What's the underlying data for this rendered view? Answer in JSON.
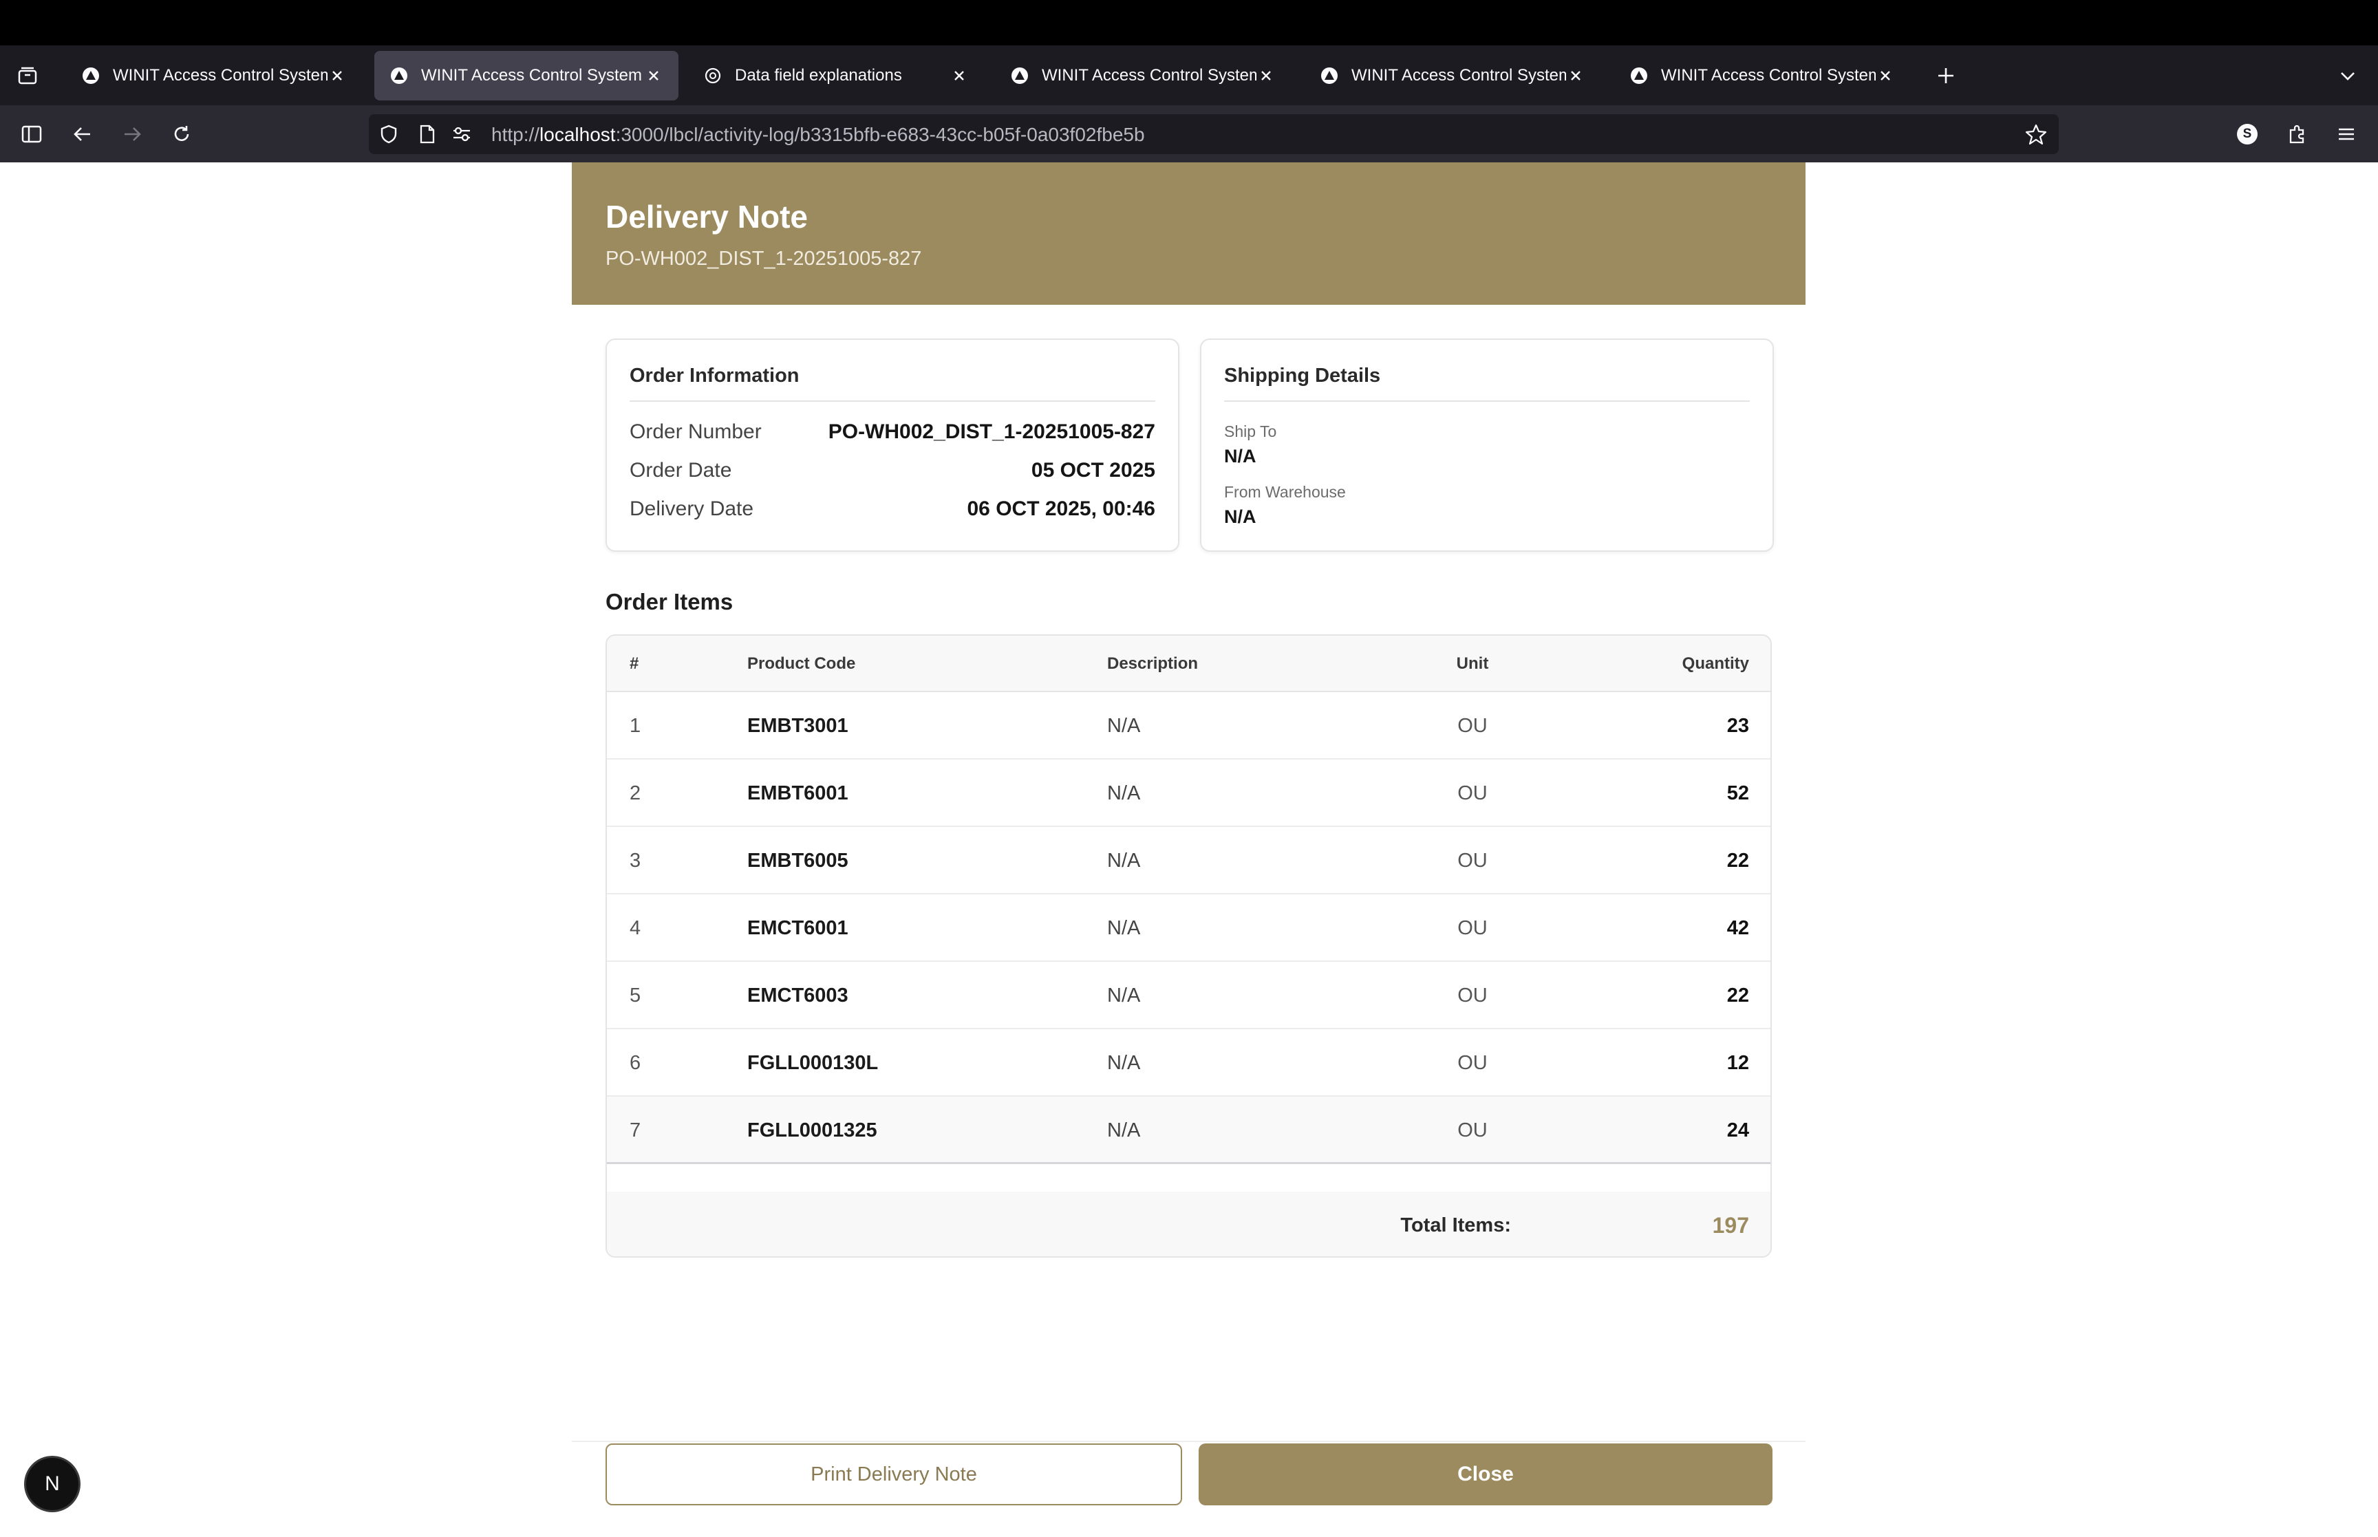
{
  "browser": {
    "tabs": [
      {
        "title": "WINIT Access Control System",
        "active": false,
        "icon": "triangle-logo-icon"
      },
      {
        "title": "WINIT Access Control System",
        "active": true,
        "icon": "triangle-logo-icon"
      },
      {
        "title": "Data field explanations",
        "active": false,
        "icon": "openai-logo-icon"
      },
      {
        "title": "WINIT Access Control System",
        "active": false,
        "icon": "triangle-logo-icon"
      },
      {
        "title": "WINIT Access Control System",
        "active": false,
        "icon": "triangle-logo-icon"
      },
      {
        "title": "WINIT Access Control System",
        "active": false,
        "icon": "triangle-logo-icon"
      }
    ],
    "url_prefix": "http://",
    "url_host": "localhost",
    "url_path": ":3000/lbcl/activity-log/b3315bfb-e683-43cc-b05f-0a03f02fbe5b",
    "account_initial": "S"
  },
  "delivery_note": {
    "title": "Delivery Note",
    "subtitle": "PO-WH002_DIST_1-20251005-827",
    "order_info": {
      "heading": "Order Information",
      "order_number_label": "Order Number",
      "order_number": "PO-WH002_DIST_1-20251005-827",
      "order_date_label": "Order Date",
      "order_date": "05 OCT 2025",
      "delivery_date_label": "Delivery Date",
      "delivery_date": "06 OCT 2025, 00:46"
    },
    "shipping": {
      "heading": "Shipping Details",
      "ship_to_label": "Ship To",
      "ship_to": "N/A",
      "from_warehouse_label": "From Warehouse",
      "from_warehouse": "N/A"
    },
    "items_heading": "Order Items",
    "columns": {
      "num": "#",
      "code": "Product Code",
      "desc": "Description",
      "unit": "Unit",
      "qty": "Quantity"
    },
    "items": [
      {
        "num": "1",
        "code": "EMBT3001",
        "desc": "N/A",
        "unit": "OU",
        "qty": "23"
      },
      {
        "num": "2",
        "code": "EMBT6001",
        "desc": "N/A",
        "unit": "OU",
        "qty": "52"
      },
      {
        "num": "3",
        "code": "EMBT6005",
        "desc": "N/A",
        "unit": "OU",
        "qty": "22"
      },
      {
        "num": "4",
        "code": "EMCT6001",
        "desc": "N/A",
        "unit": "OU",
        "qty": "42"
      },
      {
        "num": "5",
        "code": "EMCT6003",
        "desc": "N/A",
        "unit": "OU",
        "qty": "22"
      },
      {
        "num": "6",
        "code": "FGLL000130L",
        "desc": "N/A",
        "unit": "OU",
        "qty": "12"
      },
      {
        "num": "7",
        "code": "FGLL0001325",
        "desc": "N/A",
        "unit": "OU",
        "qty": "24"
      }
    ],
    "total_label": "Total Items:",
    "total_value": "197",
    "print_label": "Print Delivery Note",
    "close_label": "Close"
  },
  "dev_badge": "N",
  "colors": {
    "accent": "#9c8b5f",
    "tab_strip": "#1c1b22",
    "toolbar": "#2b2a33"
  }
}
